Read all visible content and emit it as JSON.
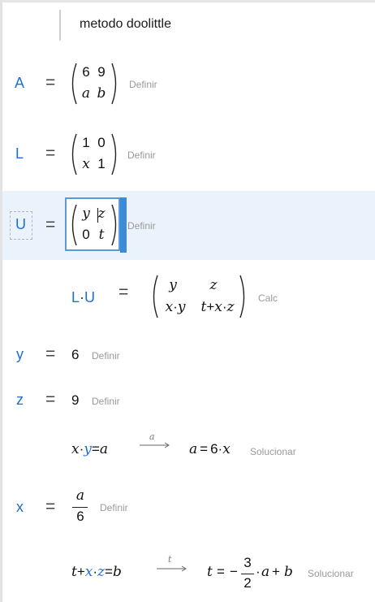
{
  "title": "metodo doolittle",
  "rows": {
    "A": {
      "name": "A",
      "eq": "=",
      "m": [
        "6",
        "9",
        "a",
        "b"
      ],
      "action": "Definir"
    },
    "L": {
      "name": "L",
      "eq": "=",
      "m": [
        "1",
        "0",
        "x",
        "1"
      ],
      "action": "Definir"
    },
    "U": {
      "name": "U",
      "eq": "=",
      "m": [
        "y",
        "z",
        "0",
        "t"
      ],
      "action": "Definir"
    },
    "LU": {
      "lhs_l": "L",
      "dot": "·",
      "lhs_u": "U",
      "eq": "=",
      "m11": "y",
      "m12": "z",
      "m21_a": "x",
      "m21_dot": "·",
      "m21_b": "y",
      "m22_a": "t",
      "m22_plus": "+",
      "m22_b": "x",
      "m22_dot": "·",
      "m22_c": "z",
      "action": "Calc"
    },
    "y": {
      "name": "y",
      "eq": "=",
      "value": "6",
      "action": "Definir"
    },
    "z": {
      "name": "z",
      "eq": "=",
      "value": "9",
      "action": "Definir"
    },
    "solve1": {
      "lhs_x": "x",
      "lhs_dot": "·",
      "lhs_y": "y",
      "lhs_eq": "=",
      "lhs_a": "a",
      "var": "a",
      "rhs_a": "a",
      "rhs_eq": "=",
      "rhs_6": "6",
      "rhs_dot": "·",
      "rhs_x": "x",
      "action": "Solucionar"
    },
    "x": {
      "name": "x",
      "eq": "=",
      "num": "a",
      "den": "6",
      "action": "Definir"
    },
    "solve2": {
      "lhs_t": "t",
      "lhs_plus": "+",
      "lhs_x": "x",
      "lhs_dot": "·",
      "lhs_z": "z",
      "lhs_eq": "=",
      "lhs_b": "b",
      "var": "t",
      "rhs_t": "t",
      "rhs_eq": "=",
      "rhs_minus": "−",
      "num": "3",
      "den": "2",
      "rhs_dot": "·",
      "rhs_a": "a",
      "rhs_plus": "+",
      "rhs_b": "b",
      "action": "Solucionar"
    }
  },
  "colors": {
    "variable": "#1f6fd1",
    "label": "#9a9a9a",
    "highlight": "#eaf3fb",
    "edit_border": "#5a9bd5"
  }
}
